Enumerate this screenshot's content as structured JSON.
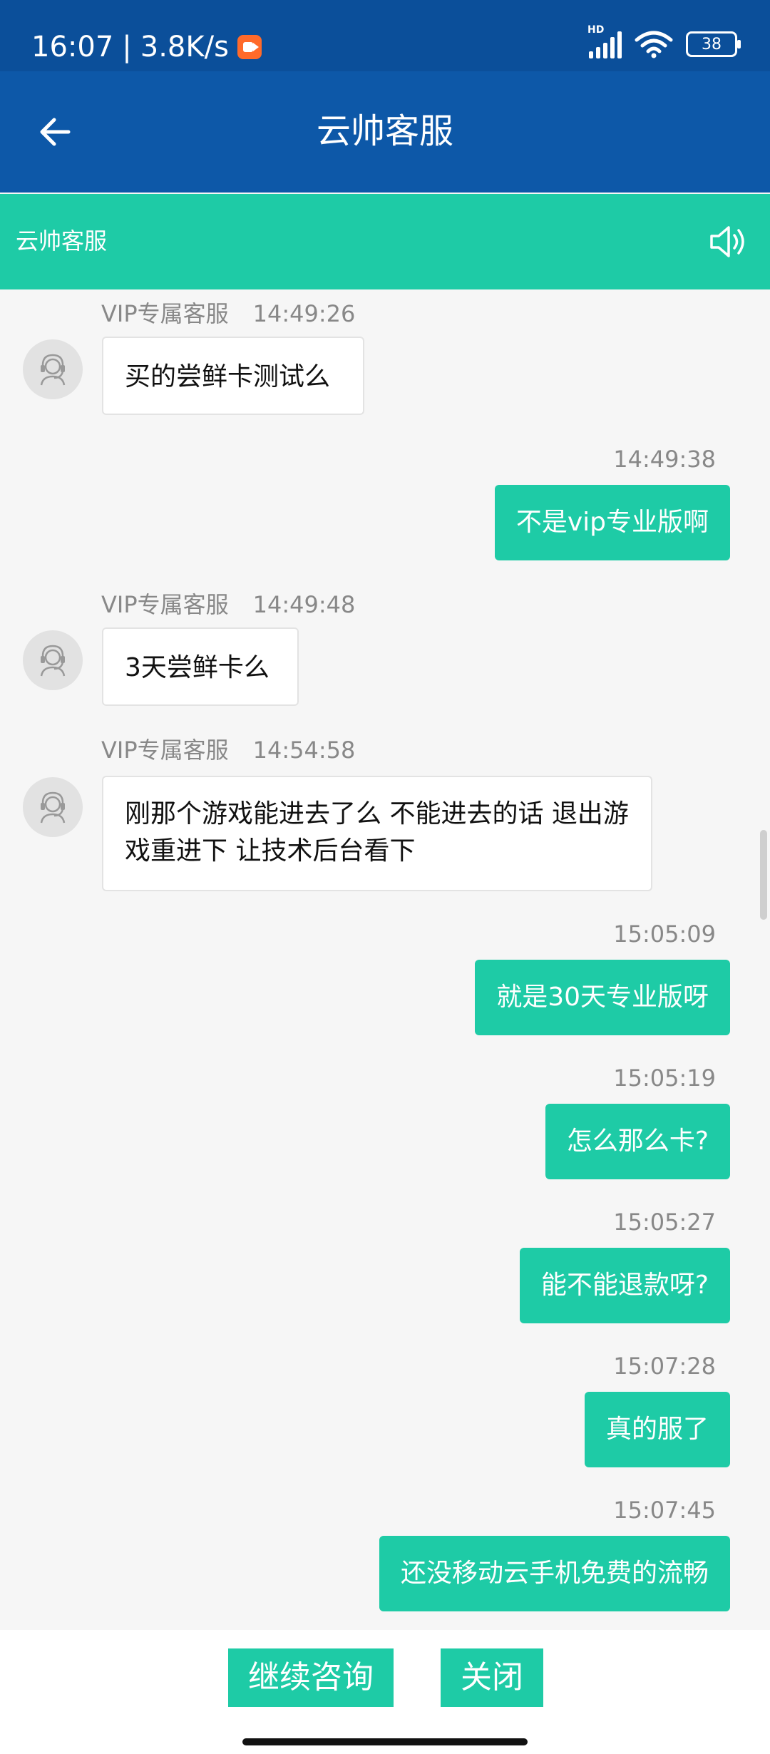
{
  "status_bar": {
    "time": "16:07",
    "network_speed": "3.8K/s",
    "hd_label": "HD",
    "battery": "38",
    "icons": [
      "screen-record-icon",
      "signal-icon",
      "wifi-icon",
      "battery-icon"
    ]
  },
  "app_bar": {
    "title": "云帅客服",
    "back_icon": "arrow-left-icon"
  },
  "sub_bar": {
    "title": "云帅客服",
    "speaker_icon": "speaker-icon"
  },
  "messages": [
    {
      "side": "in",
      "sender": "VIP专属客服",
      "time": "14:49:26",
      "text": "买的尝鲜卡测试么"
    },
    {
      "side": "out",
      "time": "14:49:38",
      "text": "不是vip专业版啊"
    },
    {
      "side": "in",
      "sender": "VIP专属客服",
      "time": "14:49:48",
      "text": "3天尝鲜卡么"
    },
    {
      "side": "in",
      "sender": "VIP专属客服",
      "time": "14:54:58",
      "text": "刚那个游戏能进去了么 不能进去的话 退出游戏重进下 让技术后台看下"
    },
    {
      "side": "out",
      "time": "15:05:09",
      "text": "就是30天专业版呀"
    },
    {
      "side": "out",
      "time": "15:05:19",
      "text": "怎么那么卡?"
    },
    {
      "side": "out",
      "time": "15:05:27",
      "text": "能不能退款呀?"
    },
    {
      "side": "out",
      "time": "15:07:28",
      "text": "真的服了"
    },
    {
      "side": "out",
      "time": "15:07:45",
      "text": "还没移动云手机免费的流畅"
    }
  ],
  "footer": {
    "continue_label": "继续咨询",
    "close_label": "关闭"
  },
  "colors": {
    "status_bar": "#0b4f9a",
    "app_bar": "#0d58a8",
    "accent": "#1ecba6",
    "chat_bg": "#f6f6f6"
  }
}
